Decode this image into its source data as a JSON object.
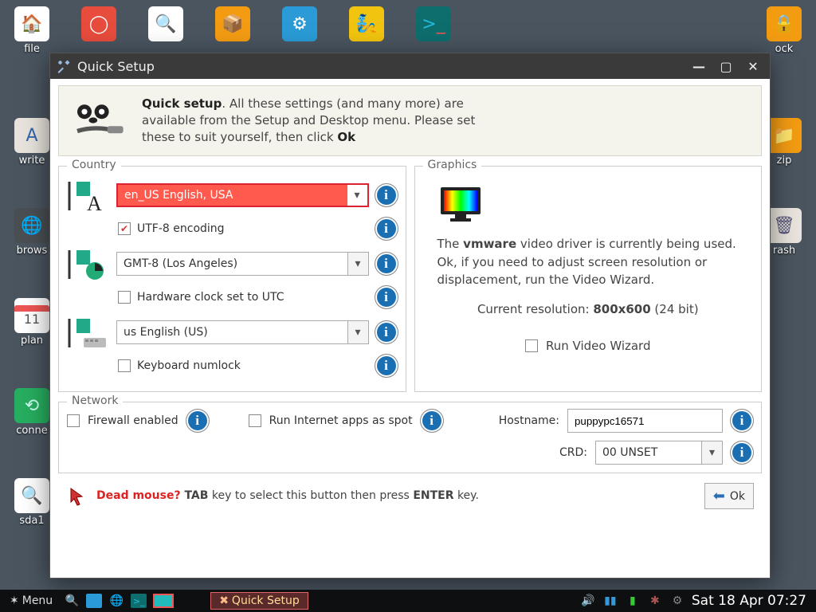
{
  "desktop": {
    "row1": [
      {
        "label": "file",
        "icon": "home-icon",
        "color": "c-white"
      },
      {
        "label": "",
        "icon": "lifebuoy-icon",
        "color": "c-red"
      },
      {
        "label": "",
        "icon": "disk-icon",
        "color": "c-black"
      },
      {
        "label": "",
        "icon": "package-icon",
        "color": "c-orange"
      },
      {
        "label": "",
        "icon": "gear-icon",
        "color": "c-blue"
      },
      {
        "label": "",
        "icon": "lamp-icon",
        "color": "c-yellow"
      },
      {
        "label": "",
        "icon": "terminal-icon",
        "color": "c-teal"
      }
    ],
    "lock": {
      "label": "ock",
      "icon": "lock-icon"
    },
    "left_col": [
      {
        "label": "write",
        "icon": "write-icon",
        "color": "c-gray"
      },
      {
        "label": "brows",
        "icon": "globe-icon",
        "color": "c-dgray"
      },
      {
        "label": "plan",
        "icon": "calendar-icon",
        "color": "c-white",
        "text": "11"
      },
      {
        "label": "conne",
        "icon": "wifi-icon",
        "color": "c-green"
      },
      {
        "label": "sda1",
        "icon": "drive-icon",
        "color": "c-black"
      }
    ],
    "right_col": [
      {
        "label": "zip",
        "icon": "folder-icon",
        "color": "c-orange"
      },
      {
        "label": "rash",
        "icon": "trash-icon",
        "color": "c-gray"
      }
    ]
  },
  "window": {
    "title": "Quick Setup",
    "intro_html_parts": {
      "bold1": "Quick setup",
      "rest": ". All these settings (and many more) are available from the Setup and Desktop menu. Please set these to suit yourself, then click ",
      "bold2": "Ok"
    },
    "country": {
      "legend": "Country",
      "locale": "en_US     English, USA",
      "utf8": "UTF-8 encoding",
      "tz": "GMT-8     (Los Angeles)",
      "hwclock": "Hardware clock set to UTC",
      "kb": "us           English (US)",
      "numlock": "Keyboard numlock"
    },
    "graphics": {
      "legend": "Graphics",
      "p1a": "The ",
      "driver": "vmware",
      "p1b": " video driver is currently being used. Ok, if you need to adjust screen resolution or displacement, run the Video Wizard.",
      "res_label": "Current resolution: ",
      "res_value": "800x600",
      "res_depth": "  (24 bit)",
      "wizard": "Run Video Wizard"
    },
    "network": {
      "legend": "Network",
      "firewall": "Firewall enabled",
      "spot": "Run Internet apps as spot",
      "host_label": "Hostname:",
      "host_value": "puppypc16571",
      "crd_label": "CRD:",
      "crd_value": "00 UNSET"
    },
    "footer": {
      "dead": "Dead mouse?",
      "tab": " TAB",
      "rest1": " key to select this button then press ",
      "enter": "ENTER",
      "rest2": " key.",
      "ok": "Ok"
    }
  },
  "taskbar": {
    "menu": "Menu",
    "active": "Quick Setup",
    "clock": "Sat 18 Apr 07:27"
  }
}
